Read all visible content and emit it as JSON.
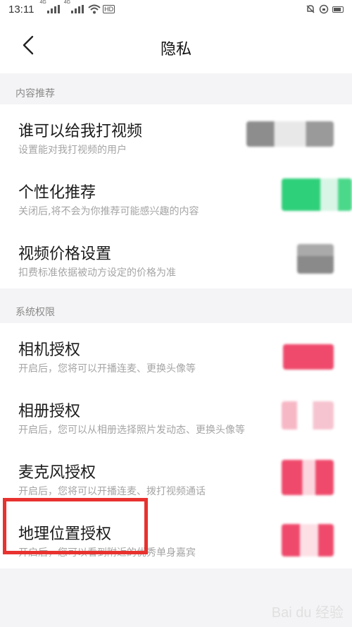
{
  "status_bar": {
    "time": "13:11",
    "net1": "4G",
    "net2": "4G",
    "hd": "HD"
  },
  "header": {
    "title": "隐私"
  },
  "sections": [
    {
      "label": "内容推荐",
      "items": [
        {
          "title": "谁可以给我打视频",
          "subtitle": "设置能对我打视频的用户"
        },
        {
          "title": "个性化推荐",
          "subtitle": "关闭后,将不会为你推荐可能感兴趣的内容"
        },
        {
          "title": "视频价格设置",
          "subtitle": "扣费标准依据被动方设定的价格为准"
        }
      ]
    },
    {
      "label": "系统权限",
      "items": [
        {
          "title": "相机授权",
          "subtitle": "开启后，您将可以开播连麦、更换头像等"
        },
        {
          "title": "相册授权",
          "subtitle": "开启后，您可以从相册选择照片发动态、更换头像等"
        },
        {
          "title": "麦克风授权",
          "subtitle": "开启后，您将可以开播连麦、拨打视频通话"
        },
        {
          "title": "地理位置授权",
          "subtitle": "开启后，您可以看到附近的优秀单身嘉宾"
        }
      ]
    }
  ],
  "colors": {
    "accent_red": "#e8322f",
    "toggle_green": "#2fd07a",
    "toggle_pink": "#ef4a6c"
  },
  "watermark": "Bai du 经验"
}
